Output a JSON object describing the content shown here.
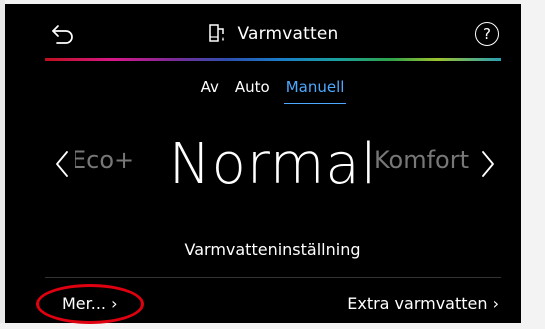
{
  "header": {
    "title": "Varmvatten",
    "help_label": "?"
  },
  "modes": [
    {
      "label": "Av"
    },
    {
      "label": "Auto"
    },
    {
      "label": "Manuell"
    }
  ],
  "selector": {
    "previous": "Eco+",
    "current": "Normal",
    "next": "Komfort"
  },
  "setting_label": "Varmvatteninställning",
  "footer": {
    "more_label": "Mer... ›",
    "extra_label": "Extra varmvatten ›"
  },
  "colors": {
    "accent": "#4ea8ff",
    "highlight": "#e00010",
    "background": "#000000"
  }
}
